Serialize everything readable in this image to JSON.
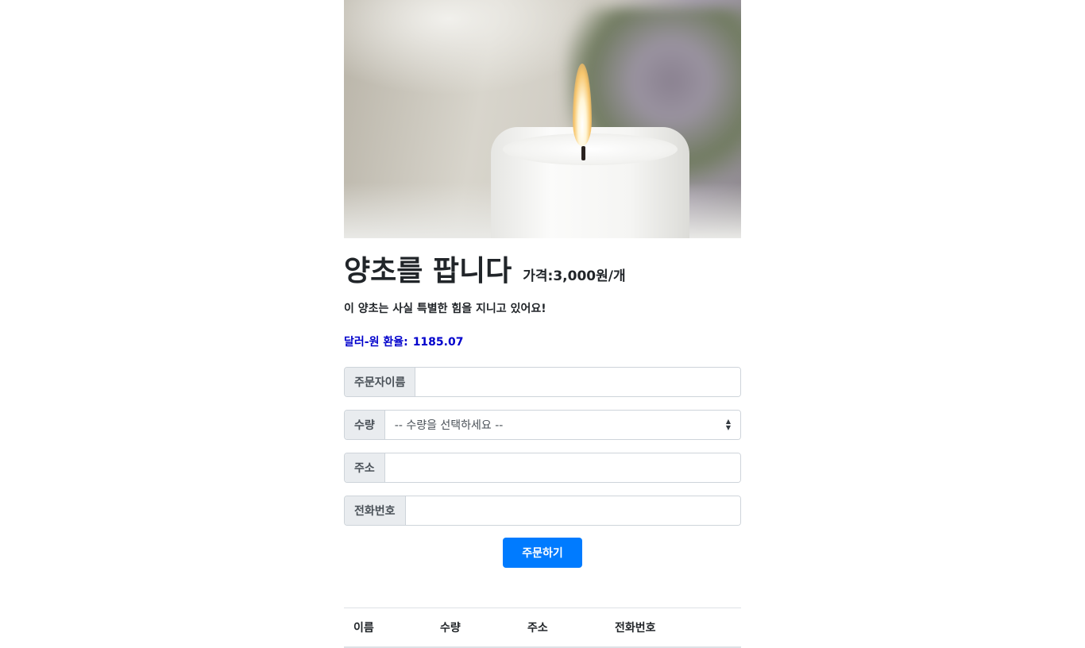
{
  "hero": {
    "image_name": "candle-photo"
  },
  "product": {
    "title": "양초를 팝니다",
    "price": "가격:3,000원/개",
    "description": "이 양초는 사실 특별한 힘을 지니고 있어요!",
    "rate_label": "달러-원 환율:",
    "rate_value": "1185.07"
  },
  "form": {
    "name_label": "주문자이름",
    "name_value": "",
    "quantity_label": "수량",
    "quantity_selected": "-- 수량을 선택하세요 --",
    "address_label": "주소",
    "address_value": "",
    "phone_label": "전화번호",
    "phone_value": "",
    "submit_label": "주문하기"
  },
  "orders_table": {
    "columns": [
      "이름",
      "수량",
      "주소",
      "전화번호"
    ],
    "rows": []
  },
  "colors": {
    "primary_button": "#007bff",
    "rate_text": "#0000cc"
  }
}
